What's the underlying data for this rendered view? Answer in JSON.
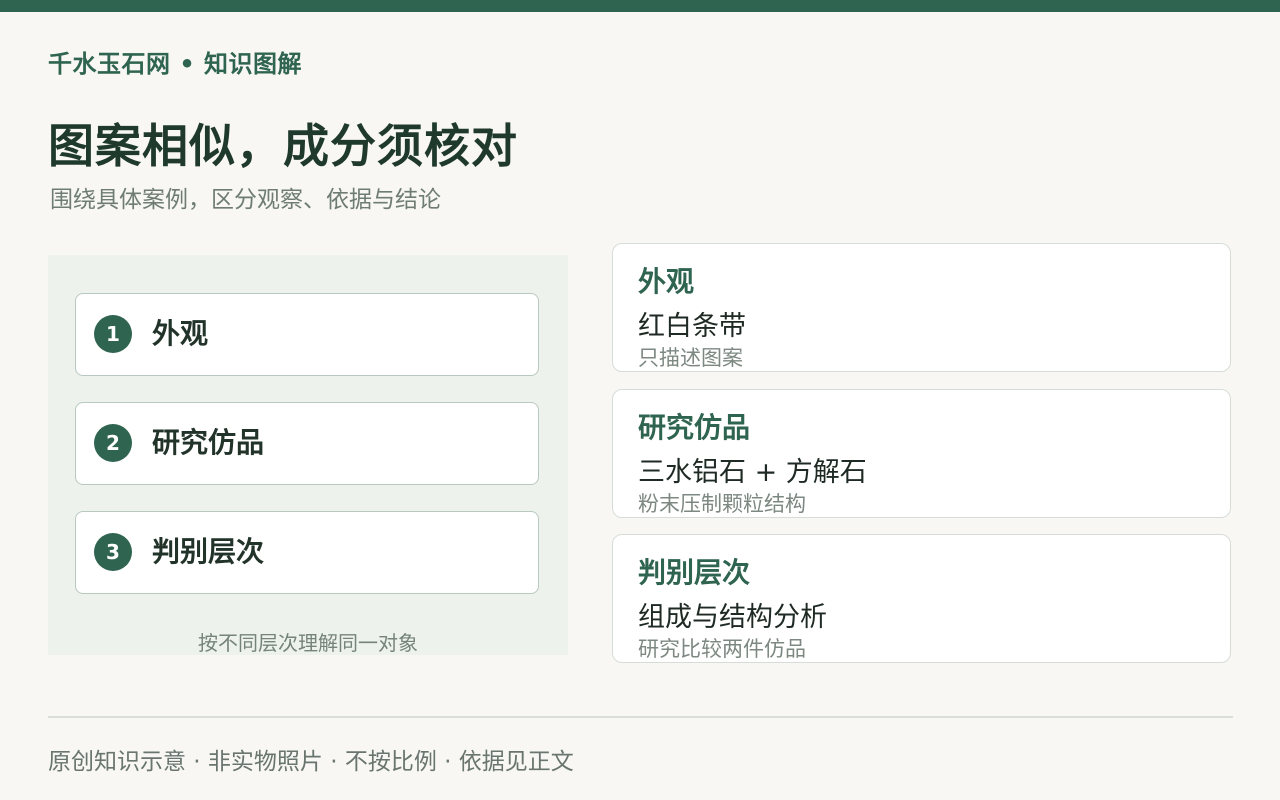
{
  "brand": "千水玉石网 • 知识图解",
  "title": "图案相似，成分须核对",
  "subtitle": "围绕具体案例，区分观察、依据与结论",
  "steps": [
    {
      "num": "1",
      "label": "外观"
    },
    {
      "num": "2",
      "label": "研究仿品"
    },
    {
      "num": "3",
      "label": "判别层次"
    }
  ],
  "panel_caption": "按不同层次理解同一对象",
  "cards": [
    {
      "title": "外观",
      "main": "红白条带",
      "note": "只描述图案"
    },
    {
      "title": "研究仿品",
      "main": "三水铝石 + 方解石",
      "note": "粉末压制颗粒结构"
    },
    {
      "title": "判别层次",
      "main": "组成与结构分析",
      "note": "研究比较两件仿品"
    }
  ],
  "footer": "原创知识示意 · 非实物照片 · 不按比例 · 依据见正文",
  "colors": {
    "accent": "#2f6450",
    "background": "#f8f7f4",
    "panel": "#edf2ed"
  }
}
